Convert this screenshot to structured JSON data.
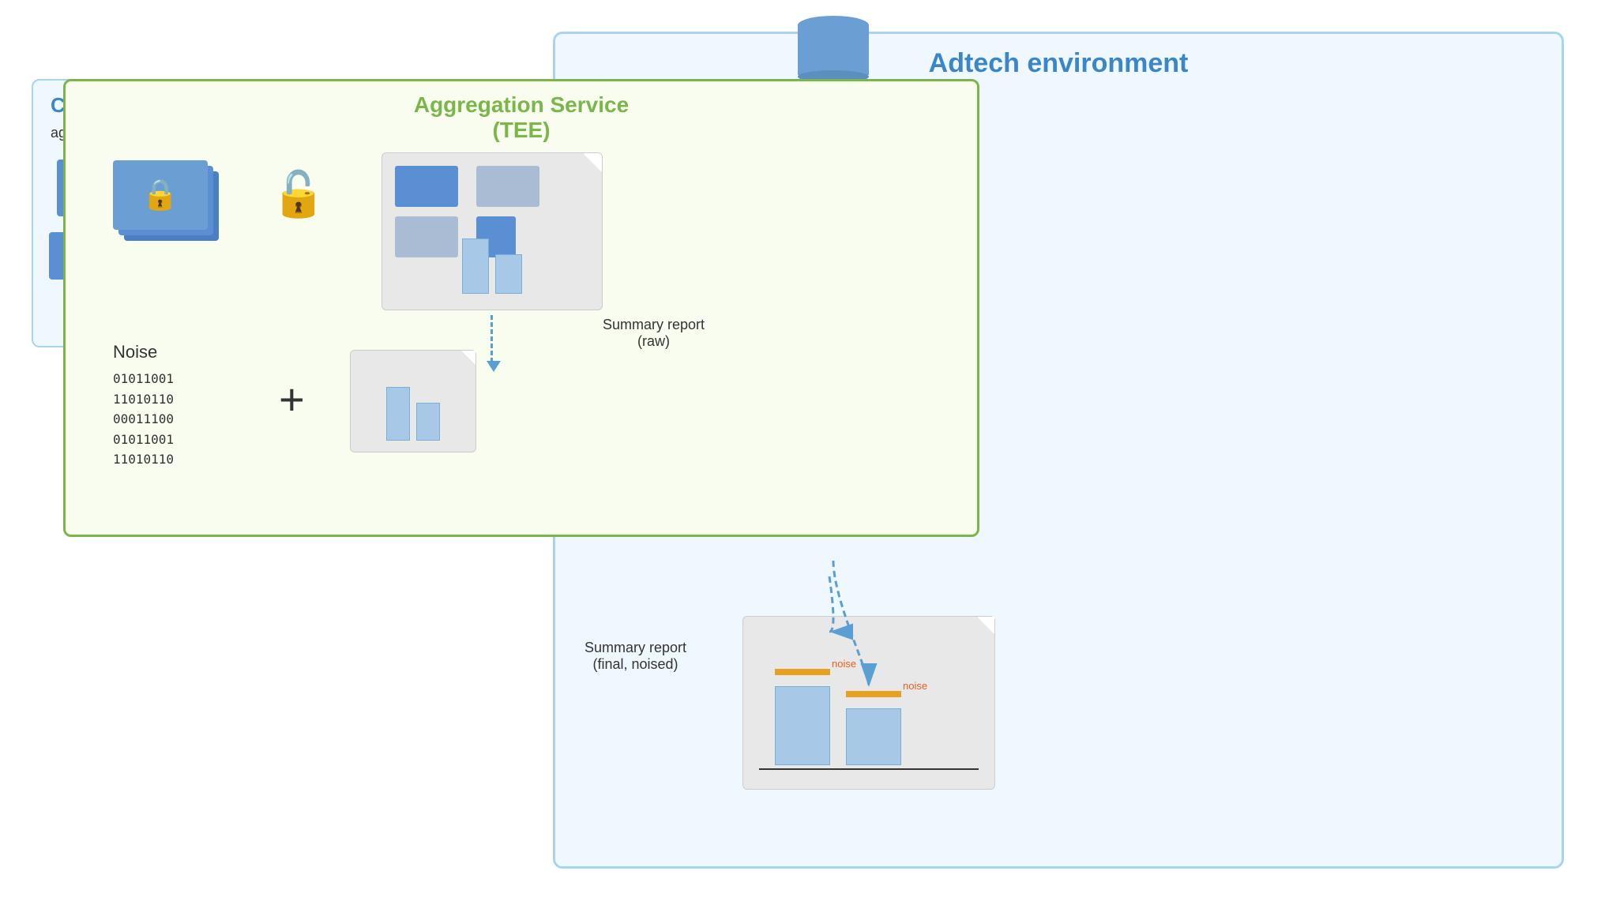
{
  "adtech": {
    "label": "Adtech environment"
  },
  "collection": {
    "label": "Collection service",
    "sublabel": "aggregatable reports"
  },
  "aggregation": {
    "line1": "Aggregation Service",
    "line2": "(TEE)"
  },
  "noise": {
    "label": "Noise",
    "binary_lines": [
      "01011001",
      "11010110",
      "00011100",
      "01011001",
      "11010110"
    ]
  },
  "plus_sign": "+",
  "summary_raw": {
    "label1": "Summary report",
    "label2": "(raw)"
  },
  "summary_final": {
    "label1": "Summary report",
    "label2": "(final, noised)"
  },
  "noise_annotation": "noise"
}
